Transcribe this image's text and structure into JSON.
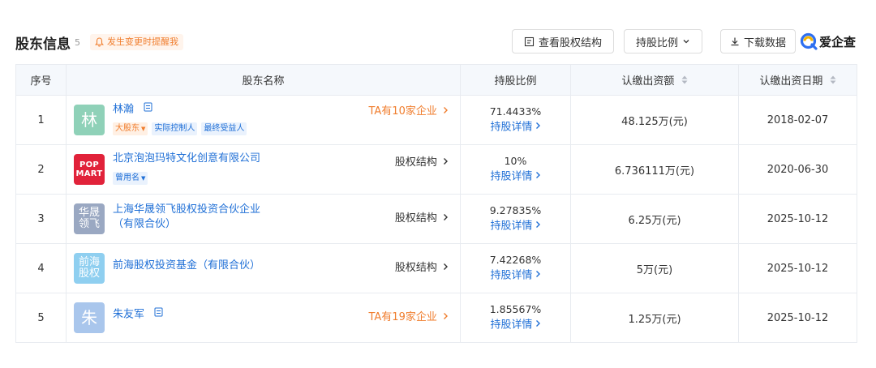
{
  "header": {
    "title": "股东信息",
    "count": "5",
    "alert_label": "发生变更时提醒我",
    "structure_button": "查看股权结构",
    "ratio_button": "持股比例",
    "download_button": "下载数据",
    "logo_text": "爱企查"
  },
  "table": {
    "columns": [
      "序号",
      "股东名称",
      "持股比例",
      "认缴出资额",
      "认缴出资日期"
    ],
    "detail_link": "持股详情",
    "rows": [
      {
        "index": "1",
        "avatar_text": "林",
        "name": "林瀚",
        "tags": [
          "大股东",
          "实际控制人",
          "最终受益人"
        ],
        "right_link": "TA有10家企业",
        "ratio": "71.4433%",
        "amount": "48.125万(元)",
        "date": "2018-02-07"
      },
      {
        "index": "2",
        "avatar_line1": "POP",
        "avatar_line2": "MART",
        "name": "北京泡泡玛特文化创意有限公司",
        "tags": [
          "曾用名"
        ],
        "right_link": "股权结构",
        "ratio": "10%",
        "amount": "6.736111万(元)",
        "date": "2020-06-30"
      },
      {
        "index": "3",
        "avatar_line1": "华晟",
        "avatar_line2": "领飞",
        "name": "上海华晟领飞股权投资合伙企业（有限合伙）",
        "right_link": "股权结构",
        "ratio": "9.27835%",
        "amount": "6.25万(元)",
        "date": "2025-10-12"
      },
      {
        "index": "4",
        "avatar_line1": "前海",
        "avatar_line2": "股权",
        "name": "前海股权投资基金（有限合伙）",
        "right_link": "股权结构",
        "ratio": "7.42268%",
        "amount": "5万(元)",
        "date": "2025-10-12"
      },
      {
        "index": "5",
        "avatar_text": "朱",
        "name": "朱友军",
        "right_link": "TA有19家企业",
        "ratio": "1.85567%",
        "amount": "1.25万(元)",
        "date": "2025-10-12"
      }
    ]
  },
  "colors": {
    "accent_blue": "#1f6fd6",
    "accent_orange": "#f07d2d",
    "header_bg": "#f5f8fc",
    "border": "#e8ebf0"
  },
  "icons": [
    "bell-icon",
    "structure-icon",
    "chevron-down-icon",
    "download-icon",
    "logo-q-icon",
    "document-icon",
    "chevron-right-icon",
    "sort-icon"
  ]
}
